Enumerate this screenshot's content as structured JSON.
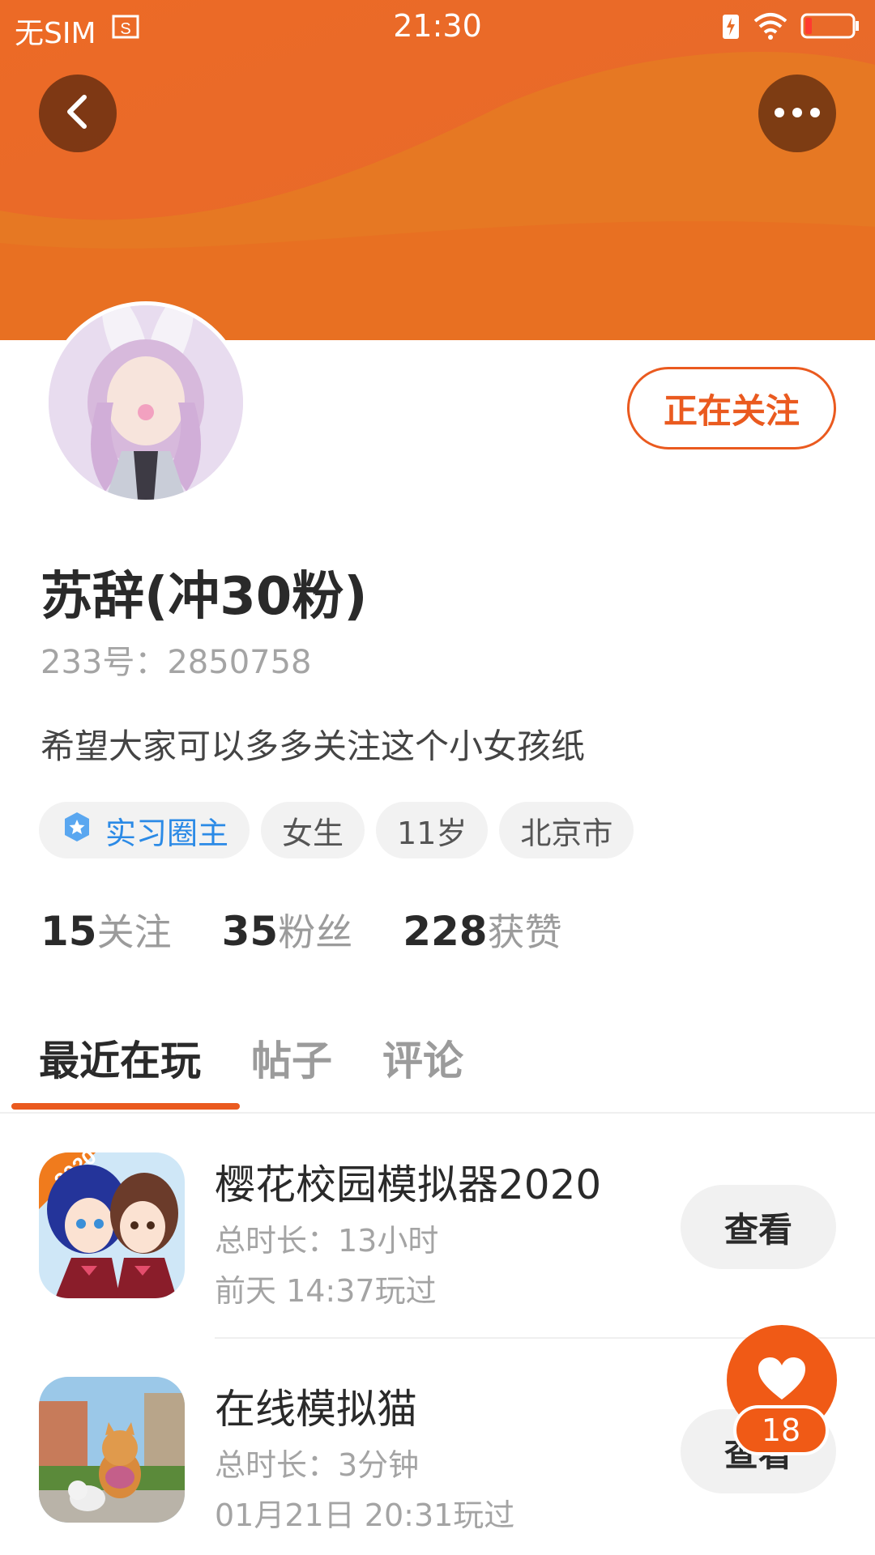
{
  "status_bar": {
    "carrier": "无SIM",
    "time": "21:30"
  },
  "profile": {
    "follow_label": "正在关注",
    "nickname": "苏辞(冲30粉)",
    "user_id": "233号：2850758",
    "bio": "希望大家可以多多关注这个小女孩纸",
    "tags": [
      "实习圈主",
      "女生",
      "11岁",
      "北京市"
    ],
    "stats": [
      {
        "num": "15",
        "label": "关注"
      },
      {
        "num": "35",
        "label": "粉丝"
      },
      {
        "num": "228",
        "label": "获赞"
      }
    ]
  },
  "tabs": [
    "最近在玩",
    "帖子",
    "评论"
  ],
  "games": [
    {
      "title": "樱花校园模拟器2020",
      "duration": "总时长：13小时",
      "last_played": "前天 14:37玩过",
      "button": "查看",
      "icon_text": "2020"
    },
    {
      "title": "在线模拟猫",
      "duration": "总时长：3分钟",
      "last_played": "01月21日 20:31玩过",
      "button": "查看"
    }
  ],
  "like": {
    "count": "18"
  },
  "colors": {
    "accent": "#ea5a1f",
    "banner": "#e8722a",
    "role_blue": "#2b8ae6"
  }
}
